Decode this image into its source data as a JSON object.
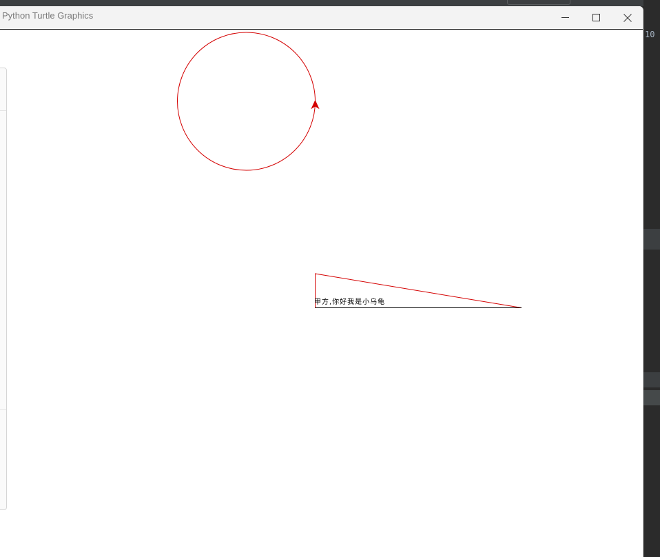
{
  "window": {
    "title": "Python Turtle Graphics"
  },
  "background": {
    "line_number": "10"
  },
  "canvas": {
    "text_label": "甲方,你好我是小乌龟",
    "pen_color": "#d40000",
    "text_color": "#000000"
  },
  "icons": {
    "minimize": "minimize-icon",
    "maximize": "maximize-icon",
    "close": "close-icon",
    "turtle": "turtle-arrow-icon"
  }
}
